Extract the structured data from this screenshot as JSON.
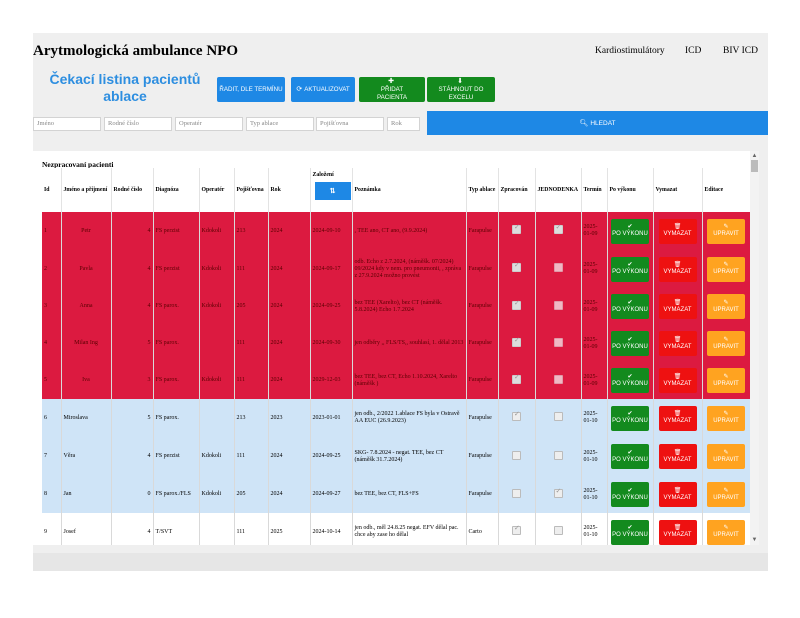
{
  "header": {
    "title": "Arytmologická ambulance NPO",
    "nav": [
      "Kardiostimulátory",
      "ICD",
      "BIV ICD"
    ]
  },
  "subtitle": "Čekací listina pacientů ablace",
  "toolbar": {
    "sort_label": "ŘADIT, DLE TERMÍNU",
    "refresh_label": "AKTUALIZOVAT",
    "add_label": "PŘIDAT PACIENTA",
    "excel_label": "STÁHNOUT DO EXCELU"
  },
  "filters": {
    "jmeno": "Jméno",
    "rodne": "Rodné číslo",
    "operator": "Operatér",
    "typ": "Typ ablace",
    "pojistovna": "Pojišťovna",
    "rok": "Rok",
    "search_label": "HLEDAT"
  },
  "panel_title": "Nezpracovaní pacienti",
  "columns": [
    "Id",
    "Jméno a příjmení",
    "Rodné číslo",
    "Diagnóza",
    "Operatér",
    "Pojišťovna",
    "Rok",
    "Založení",
    "Poznámka",
    "Typ ablace",
    "Zpracován",
    "JEDNODENKA",
    "Termín",
    "Po výkonu",
    "Vymazat",
    "Editace"
  ],
  "actions": {
    "done": "PO VÝKONU",
    "delete": "VYMAZAT",
    "edit": "UPRAVIT"
  },
  "rows": [
    {
      "style": "red",
      "id": "1",
      "name": "Petr",
      "rc": "4",
      "dg": "FS perzist",
      "op": "Kdokoli",
      "poj": "213",
      "rok": "2024",
      "zal": "2024-09-10",
      "note": ", TEE ano, CT ano, (9.9.2024)",
      "typ": "Farapulse",
      "zpr": true,
      "jed": true,
      "term": "2025-01-09"
    },
    {
      "style": "red",
      "id": "2",
      "name": "Pavla",
      "rc": "4",
      "dg": "FS perzist",
      "op": "Kdokoli",
      "poj": "111",
      "rok": "2024",
      "zal": "2024-09-17",
      "note": "odb. Echo z 2.7.2024, (náměšk. 07/2024) 09/2024 kdy v nem. pro pneumonii, , zpráva z 27.9.2024 možno provést",
      "typ": "Farapulse",
      "zpr": true,
      "jed": false,
      "term": "2025-01-09"
    },
    {
      "style": "red",
      "id": "3",
      "name": "Anna",
      "rc": "4",
      "dg": "FS parox.",
      "op": "Kdokoli",
      "poj": "205",
      "rok": "2024",
      "zal": "2024-09-25",
      "note": "bez TEE (Xarelto), bez CT (náměšk. 5.8.2024) Echo 1.7.2024",
      "typ": "Farapulse",
      "zpr": true,
      "jed": false,
      "term": "2025-01-09"
    },
    {
      "style": "red",
      "id": "4",
      "name": "Milan Ing",
      "rc": "5",
      "dg": "FS parox.",
      "op": "",
      "poj": "111",
      "rok": "2024",
      "zal": "2024-09-30",
      "note": "jen odběry ,, FLS/TS,, souhlasí, 1. dělal 2013",
      "typ": "Farapulse",
      "zpr": true,
      "jed": false,
      "term": "2025-01-09"
    },
    {
      "style": "red",
      "id": "5",
      "name": "Iva",
      "rc": "3",
      "dg": "FS parox.",
      "op": "Kdokoli",
      "poj": "111",
      "rok": "2024",
      "zal": "2029-12-03",
      "note": "bez TEE, bez CT, Echo 1.10.2024, Xarelto (náměšk )",
      "typ": "Farapulse",
      "zpr": true,
      "jed": false,
      "term": "2025-01-09"
    },
    {
      "style": "blue",
      "id": "6",
      "name": "Miroslava",
      "rc": "5",
      "dg": "FS parox.",
      "op": "",
      "poj": "213",
      "rok": "2023",
      "zal": "2023-01-01",
      "note": "jen odb., 2/2022 1.ablace FS byla v Ostravě AA EUC (26.9.2023)",
      "typ": "Farapulse",
      "zpr": true,
      "jed": false,
      "term": "2025-01-10"
    },
    {
      "style": "blue",
      "id": "7",
      "name": "Věra",
      "rc": "4",
      "dg": "FS perzist",
      "op": "Kdokoli",
      "poj": "111",
      "rok": "2024",
      "zal": "2024-09-25",
      "note": "SKG- 7.8.2024 - negat. TEE, bez CT (náměšk 31.7.2024)",
      "typ": "Farapulse",
      "zpr": false,
      "jed": false,
      "term": "2025-01-10"
    },
    {
      "style": "blue",
      "id": "8",
      "name": "Jan",
      "rc": "0",
      "dg": "FS parox./FLS",
      "op": "Kdokoli",
      "poj": "205",
      "rok": "2024",
      "zal": "2024-09-27",
      "note": "bez TEE, bez CT, FLS+FS",
      "typ": "Farapulse",
      "zpr": false,
      "jed": true,
      "term": "2025-01-10"
    },
    {
      "style": "white",
      "id": "9",
      "name": "Josef",
      "rc": "4",
      "dg": "T/SVT",
      "op": "",
      "poj": "111",
      "rok": "2025",
      "zal": "2024-10-14",
      "note": "jen odb., měl 24.8.25 negat. EFV dělal pac. chce aby zase ho dělal",
      "typ": "Carto",
      "zpr": true,
      "jed": false,
      "term": "2025-01-10"
    }
  ],
  "colors": {
    "accent": "#1e88e5",
    "green": "#138a1e",
    "red": "#ee1111",
    "orange": "#ffa320",
    "row_red": "#dc1a40",
    "row_blue": "#cfe4f7"
  }
}
